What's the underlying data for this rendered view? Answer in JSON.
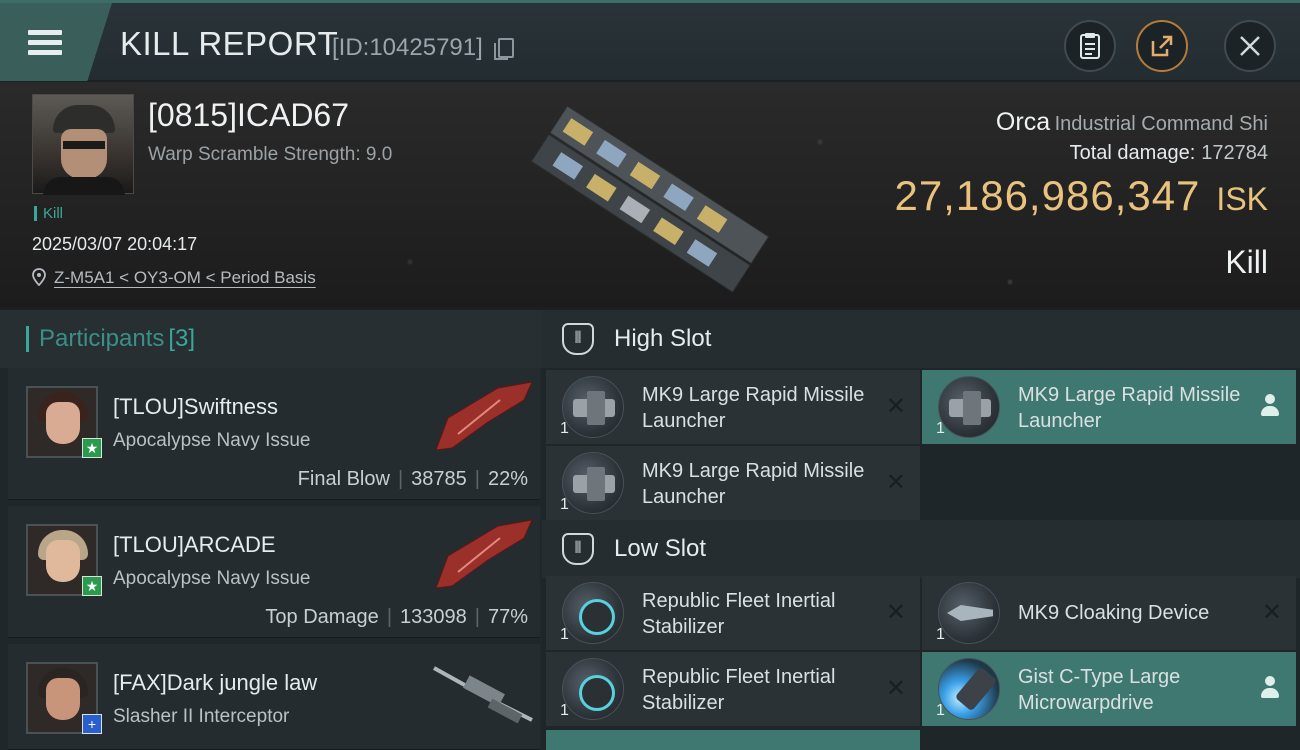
{
  "header": {
    "title": "KILL REPORT",
    "report_id": "[ID:10425791]",
    "icons": [
      "menu-icon",
      "copy-icon",
      "clipboard-icon",
      "share-icon",
      "close-icon"
    ]
  },
  "victim": {
    "name": "[0815]ICAD67",
    "warp_scramble": "Warp Scramble Strength: 9.0",
    "tag": "Kill",
    "datetime": "2025/03/07 20:04:17",
    "location": "Z-M5A1 < OY3-OM < Period Basis",
    "ship_name": "Orca",
    "ship_class": "Industrial Command Shi",
    "total_damage_label": "Total damage:",
    "total_damage_value": "172784",
    "isk_value": "27,186,986,347",
    "isk_unit": "ISK",
    "result": "Kill"
  },
  "participants": {
    "label": "Participants",
    "count": "[3]",
    "items": [
      {
        "name": "[TLOU]Swiftness",
        "ship": "Apocalypse Navy Issue",
        "stat_label": "Final Blow",
        "damage": "38785",
        "percent": "22%"
      },
      {
        "name": "[TLOU]ARCADE",
        "ship": "Apocalypse Navy Issue",
        "stat_label": "Top Damage",
        "damage": "133098",
        "percent": "77%"
      },
      {
        "name": "[FAX]Dark jungle law",
        "ship": "Slasher II Interceptor"
      }
    ]
  },
  "slots": {
    "high": {
      "label": "High Slot",
      "modules": [
        {
          "name": "MK9 Large Rapid Missile Launcher",
          "qty": "1"
        },
        {
          "name": "MK9 Large Rapid Missile Launcher",
          "qty": "1"
        },
        {
          "name": "MK9 Large Rapid Missile Launcher",
          "qty": "1"
        }
      ]
    },
    "low": {
      "label": "Low Slot",
      "modules": [
        {
          "name": "Republic Fleet Inertial Stabilizer",
          "qty": "1"
        },
        {
          "name": "MK9 Cloaking Device",
          "qty": "1"
        },
        {
          "name": "Republic Fleet Inertial Stabilizer",
          "qty": "1"
        },
        {
          "name": "Gist C-Type Large Microwarpdrive",
          "qty": "1"
        }
      ]
    }
  },
  "colors": {
    "accent": "#3aa79a",
    "isk_gold": "#e9c27d",
    "teal_row": "#3f7870",
    "close_orange": "#b67a3a"
  }
}
